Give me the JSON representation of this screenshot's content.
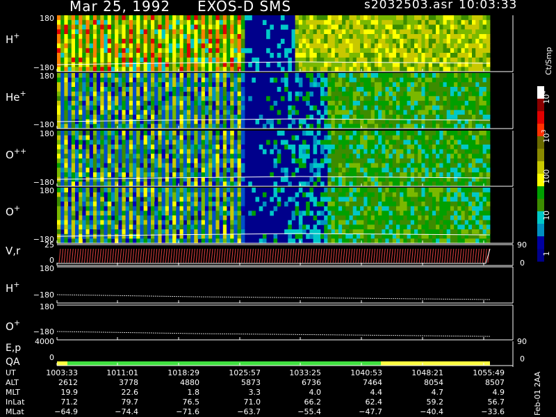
{
  "header": {
    "date": "Mar 25, 1992",
    "mission": "EXOS-D SMS",
    "file": "s2032503.asr",
    "time": "10:03:33"
  },
  "panels": [
    {
      "label": "H",
      "sup": "+",
      "top": "180",
      "bottom": "−180"
    },
    {
      "label": "He",
      "sup": "+",
      "top": "180",
      "bottom": "−180"
    },
    {
      "label": "O",
      "sup": "++",
      "top": "180",
      "bottom": "−180"
    },
    {
      "label": "O",
      "sup": "+",
      "top": "180",
      "bottom": "−180"
    }
  ],
  "vr_panel": {
    "label": "V,r",
    "top": "25",
    "bottom": "0",
    "right_top": "90",
    "right_bottom": "0"
  },
  "line_panels": [
    {
      "label": "H",
      "sup": "+",
      "top": "180",
      "bottom": "−180"
    },
    {
      "label": "O",
      "sup": "+",
      "top": "180",
      "bottom": "−180"
    }
  ],
  "ep_panel": {
    "label1": "E,p",
    "label2": "QA",
    "top": "4000",
    "bottom": "0",
    "right_top": "90",
    "right_bottom": "0"
  },
  "colorbar": {
    "unit": "Ct/Smp",
    "ticks": [
      "10",
      "10",
      "100",
      "10",
      "1"
    ],
    "tick_sups": [
      "4",
      "3",
      "",
      "",
      ""
    ],
    "colors": [
      "#ffffff",
      "#8b0000",
      "#e00000",
      "#ff3000",
      "#6b6b00",
      "#8a8a00",
      "#c8c800",
      "#ffff00",
      "#00a000",
      "#3c8c00",
      "#00c8c8",
      "#0090c0",
      "#0000a0",
      "#00008b"
    ]
  },
  "footer_labels": [
    "UT",
    "ALT",
    "MLT",
    "InLat",
    "MLat"
  ],
  "footer_columns": [
    {
      "UT": "1003:33",
      "ALT": "2612",
      "MLT": "19.9",
      "InLat": "71.2",
      "MLat": "−64.9"
    },
    {
      "UT": "1011:01",
      "ALT": "3778",
      "MLT": "22.6",
      "InLat": "79.7",
      "MLat": "−74.4"
    },
    {
      "UT": "1018:29",
      "ALT": "4880",
      "MLT": "1.8",
      "InLat": "76.5",
      "MLat": "−71.6"
    },
    {
      "UT": "1025:57",
      "ALT": "5873",
      "MLT": "3.3",
      "InLat": "71.0",
      "MLat": "−63.7"
    },
    {
      "UT": "1033:25",
      "ALT": "6736",
      "MLT": "4.0",
      "InLat": "66.2",
      "MLat": "−55.4"
    },
    {
      "UT": "1040:53",
      "ALT": "7464",
      "MLT": "4.4",
      "InLat": "62.4",
      "MLat": "−47.7"
    },
    {
      "UT": "1048:21",
      "ALT": "8054",
      "MLT": "4.7",
      "InLat": "59.2",
      "MLat": "−40.4"
    },
    {
      "UT": "1055:49",
      "ALT": "8507",
      "MLT": "4.9",
      "InLat": "56.7",
      "MLat": "−33.6"
    }
  ],
  "side_note": "Feb-01 2AA",
  "qa_segments": [
    {
      "color": "#ffff40",
      "from": "1003:33",
      "to": "1004:50"
    },
    {
      "color": "#40e040",
      "from": "1004:50",
      "to": "1046:10"
    },
    {
      "color": "#ffff40",
      "from": "1046:10",
      "to": "1057:30"
    }
  ],
  "chart_data": {
    "type": "heatmap",
    "title": "Mar 25, 1992 EXOS-D SMS",
    "x_ticks": [
      "1003:33",
      "1011:01",
      "1018:29",
      "1025:57",
      "1033:25",
      "1040:53",
      "1048:21",
      "1055:49"
    ],
    "series": [
      {
        "name": "H+",
        "ylim": [
          -180,
          180
        ]
      },
      {
        "name": "He+",
        "ylim": [
          -180,
          180
        ]
      },
      {
        "name": "O++",
        "ylim": [
          -180,
          180
        ]
      },
      {
        "name": "O+",
        "ylim": [
          -180,
          180
        ]
      },
      {
        "name": "V,r",
        "ylim": [
          0,
          25
        ]
      },
      {
        "name": "H+",
        "ylim": [
          -180,
          180
        ]
      },
      {
        "name": "O+",
        "ylim": [
          -180,
          180
        ]
      },
      {
        "name": "E,p",
        "ylim": [
          0,
          4000
        ]
      }
    ],
    "colorbar_unit": "Ct/Smp",
    "colorbar_scale": "log",
    "colorbar_range": [
      1,
      10000
    ]
  }
}
